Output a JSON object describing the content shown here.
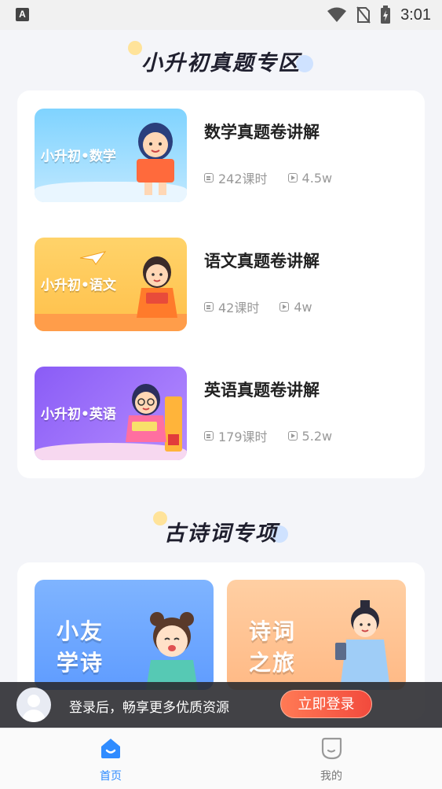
{
  "status_bar": {
    "time": "3:01",
    "indicator": "A"
  },
  "colors": {
    "accent": "#2f8cff",
    "login_button": "#f24a3d",
    "muted": "#999999"
  },
  "section_exam": {
    "title": "小升初真题专区",
    "courses": [
      {
        "thumb_label": "小升初•数学",
        "title": "数学真题卷讲解",
        "lessons": "242课时",
        "views": "4.5w"
      },
      {
        "thumb_label": "小升初•语文",
        "title": "语文真题卷讲解",
        "lessons": "42课时",
        "views": "4w"
      },
      {
        "thumb_label": "小升初•英语",
        "title": "英语真题卷讲解",
        "lessons": "179课时",
        "views": "5.2w"
      }
    ]
  },
  "section_poetry": {
    "title": "古诗词专项",
    "items": [
      {
        "line1": "小友",
        "line2": "学诗"
      },
      {
        "line1": "诗词",
        "line2": "之旅"
      }
    ]
  },
  "login_banner": {
    "text": "登录后，畅享更多优质资源",
    "button": "立即登录"
  },
  "bottom_nav": {
    "items": [
      {
        "label": "首页",
        "icon": "home-icon",
        "active": true
      },
      {
        "label": "我的",
        "icon": "profile-icon",
        "active": false
      }
    ]
  }
}
